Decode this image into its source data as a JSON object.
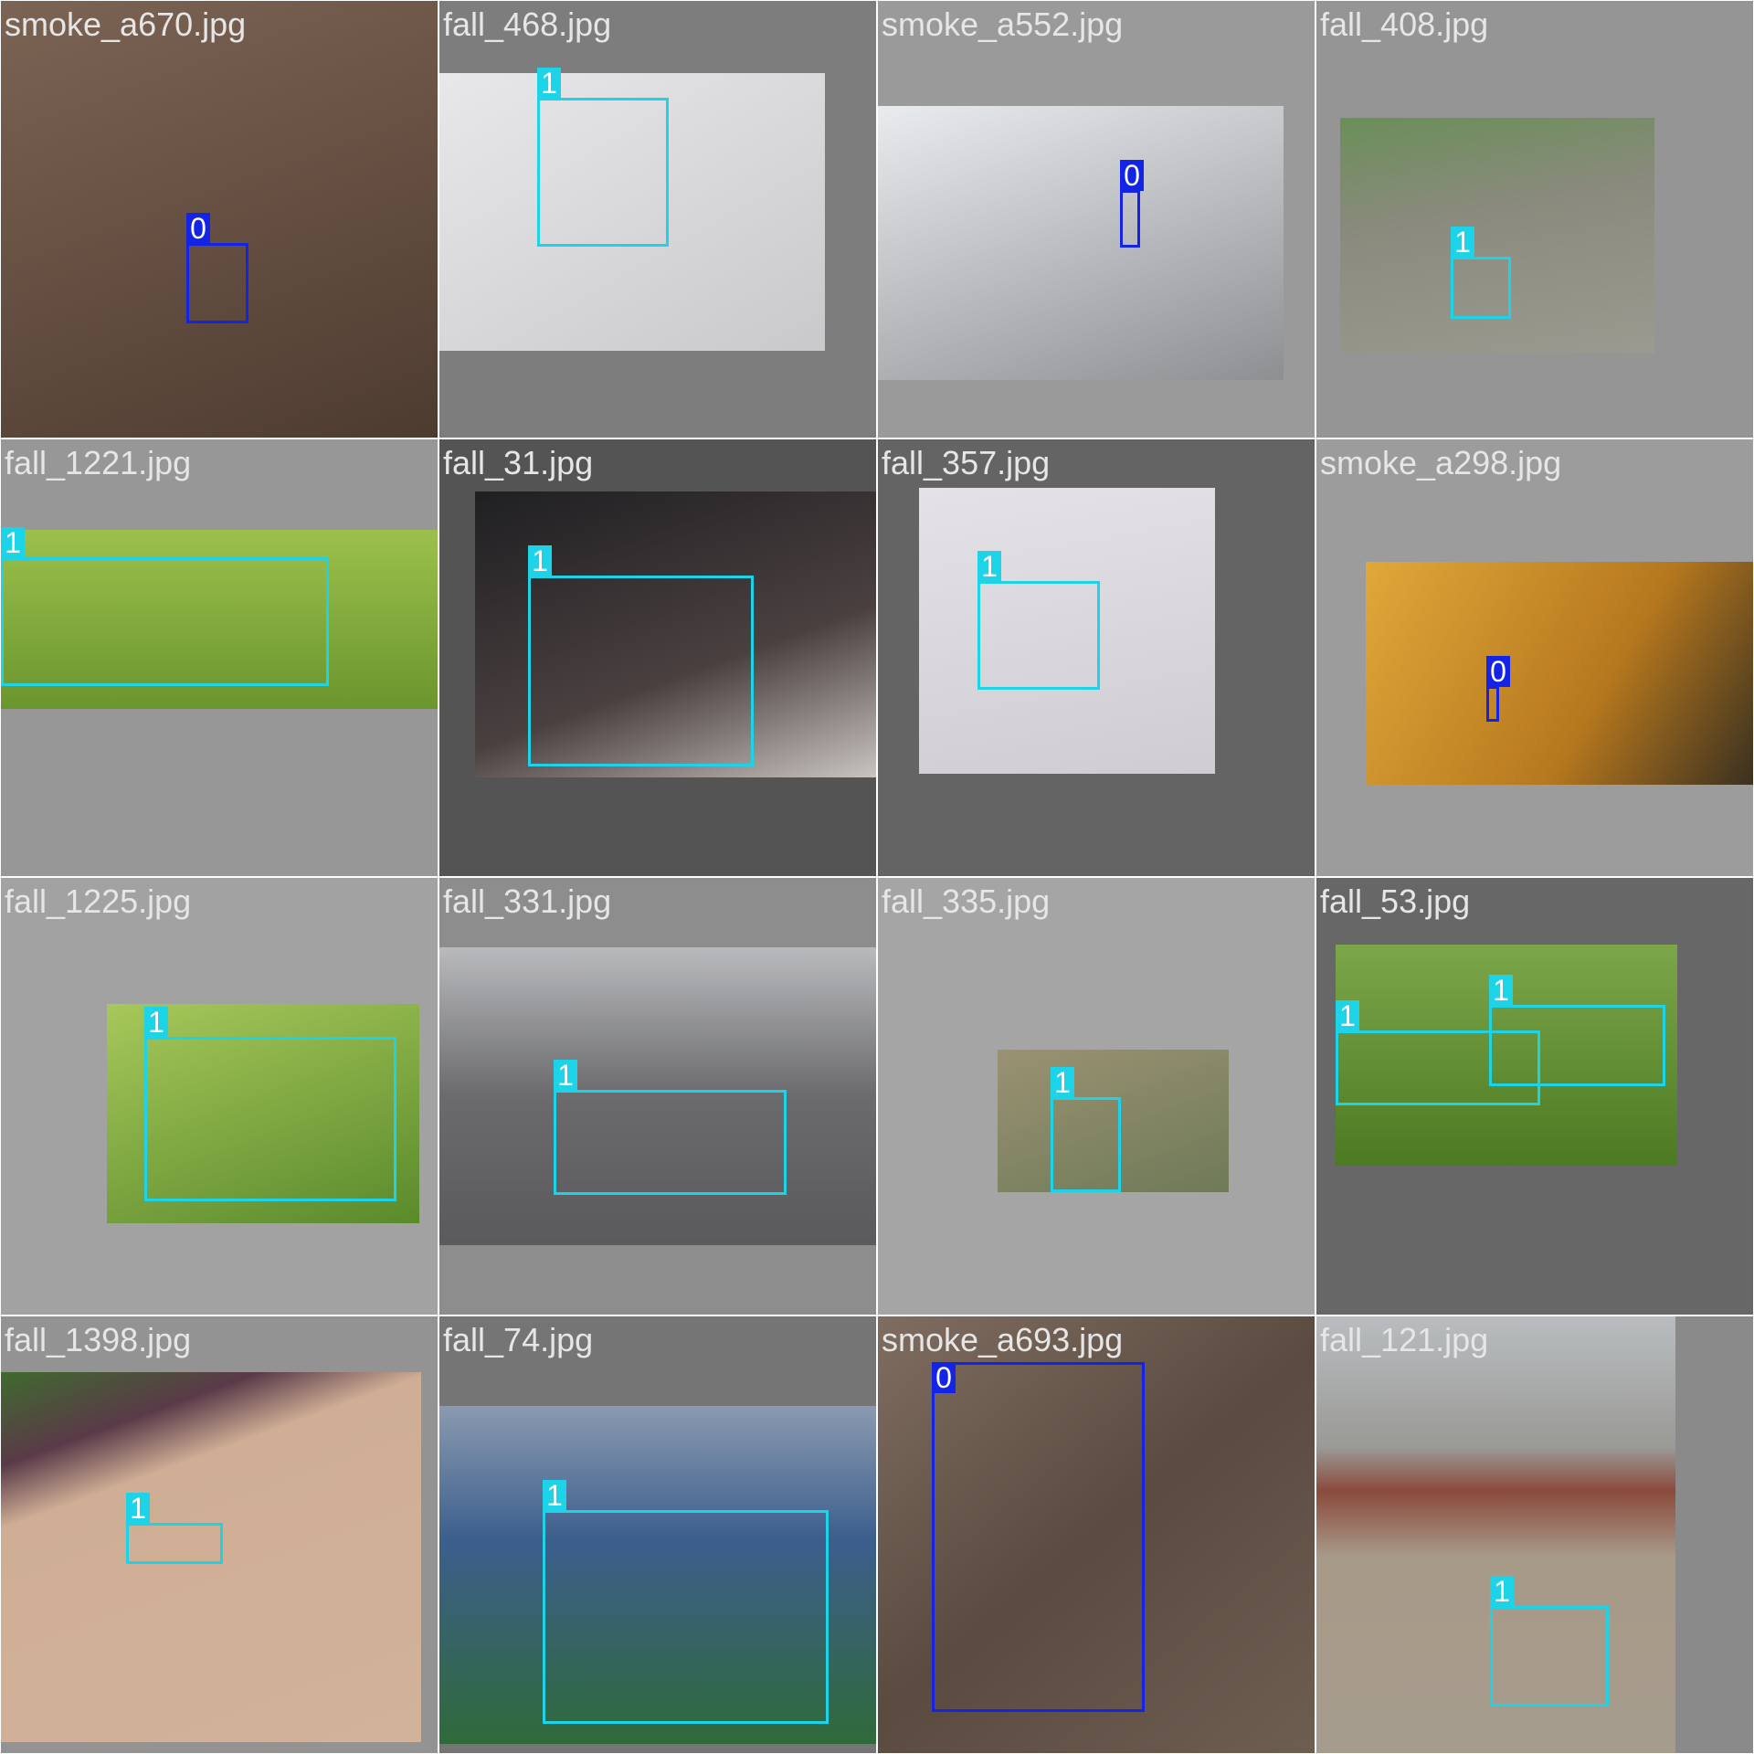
{
  "colors": {
    "class_0": "#1424e6",
    "class_1": "#1cd3e8",
    "caption_text": "#e6e6e6"
  },
  "tiles": [
    {
      "name": "smoke_a670.jpg",
      "bg": "#8c8c8c",
      "photo": "#6d5546",
      "labels": [
        "0"
      ]
    },
    {
      "name": "fall_468.jpg",
      "bg": "#7d7d7d",
      "photo": "#d8d8da",
      "labels": [
        "1"
      ]
    },
    {
      "name": "smoke_a552.jpg",
      "bg": "#9a9a9a",
      "photo": "#d9dde2",
      "labels": [
        "0"
      ]
    },
    {
      "name": "fall_408.jpg",
      "bg": "#959595",
      "photo": "#8a8a7d",
      "labels": [
        "1"
      ]
    },
    {
      "name": "fall_1221.jpg",
      "bg": "#979797",
      "photo": "#7aa43c",
      "labels": [
        "1"
      ]
    },
    {
      "name": "fall_31.jpg",
      "bg": "#545454",
      "photo": "#3b3535",
      "labels": [
        "1"
      ]
    },
    {
      "name": "fall_357.jpg",
      "bg": "#646464",
      "photo": "#d6d3d6",
      "labels": [
        "1"
      ]
    },
    {
      "name": "smoke_a298.jpg",
      "bg": "#9c9c9c",
      "photo": "#c6912f",
      "labels": [
        "0"
      ]
    },
    {
      "name": "fall_1225.jpg",
      "bg": "#a2a2a2",
      "photo": "#6f9a3a",
      "labels": [
        "1"
      ]
    },
    {
      "name": "fall_331.jpg",
      "bg": "#8d8d8d",
      "photo": "#6e6e70",
      "labels": [
        "1"
      ]
    },
    {
      "name": "fall_335.jpg",
      "bg": "#a5a5a5",
      "photo": "#8e8466",
      "labels": [
        "1"
      ]
    },
    {
      "name": "fall_53.jpg",
      "bg": "#676767",
      "photo": "#5d8a2e",
      "labels": [
        "1",
        "1"
      ]
    },
    {
      "name": "fall_1398.jpg",
      "bg": "#939393",
      "photo": "#c8a58c",
      "labels": [
        "1"
      ]
    },
    {
      "name": "fall_74.jpg",
      "bg": "#757575",
      "photo": "#3c5e8c",
      "labels": [
        "1"
      ]
    },
    {
      "name": "smoke_a693.jpg",
      "bg": "#6b5a4e",
      "photo": "#6b5a4e",
      "labels": [
        "0"
      ]
    },
    {
      "name": "fall_121.jpg",
      "bg": "#8a8a8a",
      "photo": "#9a8e7e",
      "labels": [
        "1"
      ]
    }
  ]
}
